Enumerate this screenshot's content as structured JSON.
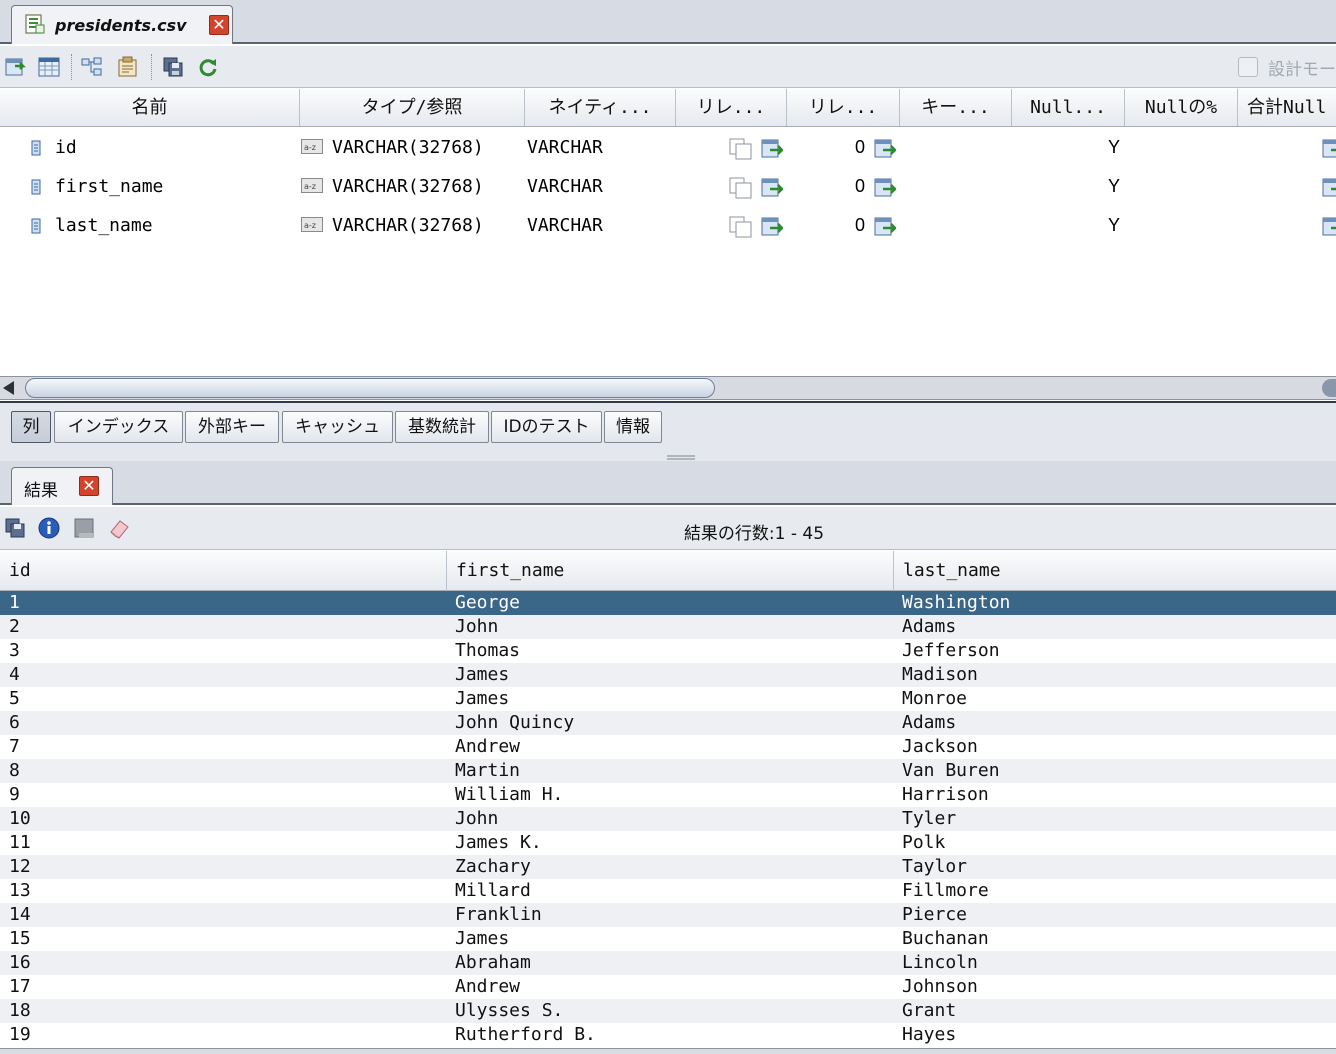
{
  "editor": {
    "file_tab_title": "presidents.csv",
    "close_label": "✕",
    "design_mode_label": "設計モー"
  },
  "column_headers": [
    "名前",
    "タイプ/参照",
    "ネイティ...",
    "リレ...",
    "リレ...",
    "キー...",
    "Null...",
    "Nullの%",
    "合計Null"
  ],
  "columns": [
    {
      "name": "id",
      "type": "VARCHAR(32768)",
      "native": "VARCHAR",
      "count": "0",
      "nullable": "Y"
    },
    {
      "name": "first_name",
      "type": "VARCHAR(32768)",
      "native": "VARCHAR",
      "count": "0",
      "nullable": "Y"
    },
    {
      "name": "last_name",
      "type": "VARCHAR(32768)",
      "native": "VARCHAR",
      "count": "0",
      "nullable": "Y"
    }
  ],
  "sub_tabs": [
    "列",
    "インデックス",
    "外部キー",
    "キャッシュ",
    "基数統計",
    "IDのテスト",
    "情報"
  ],
  "results": {
    "tab_title": "結果",
    "close_label": "✕",
    "row_count_label": "結果の行数:1 - 45",
    "headers": [
      "id",
      "first_name",
      "last_name"
    ],
    "rows": [
      [
        "1",
        "George",
        "Washington"
      ],
      [
        "2",
        "John",
        "Adams"
      ],
      [
        "3",
        "Thomas",
        "Jefferson"
      ],
      [
        "4",
        "James",
        "Madison"
      ],
      [
        "5",
        "James",
        "Monroe"
      ],
      [
        "6",
        "John Quincy",
        "Adams"
      ],
      [
        "7",
        "Andrew",
        "Jackson"
      ],
      [
        "8",
        "Martin",
        "Van Buren"
      ],
      [
        "9",
        "William H.",
        "Harrison"
      ],
      [
        "10",
        "John",
        "Tyler"
      ],
      [
        "11",
        "James K.",
        "Polk"
      ],
      [
        "12",
        "Zachary",
        "Taylor"
      ],
      [
        "13",
        "Millard",
        "Fillmore"
      ],
      [
        "14",
        "Franklin",
        "Pierce"
      ],
      [
        "15",
        "James",
        "Buchanan"
      ],
      [
        "16",
        "Abraham",
        "Lincoln"
      ],
      [
        "17",
        "Andrew",
        "Johnson"
      ],
      [
        "18",
        "Ulysses S.",
        "Grant"
      ],
      [
        "19",
        "Rutherford B.",
        "Hayes"
      ]
    ]
  },
  "icons": {
    "toolbar": [
      "add-column-icon",
      "table-grid-icon",
      "relations-icon",
      "properties-icon",
      "save-icon",
      "refresh-icon"
    ],
    "results_toolbar": [
      "save-results-icon",
      "info-icon",
      "stop-icon",
      "eraser-icon"
    ]
  },
  "colors": {
    "selected_row": "#3a6688",
    "close_button": "#d2442c",
    "chrome": "#d6dbe4"
  }
}
